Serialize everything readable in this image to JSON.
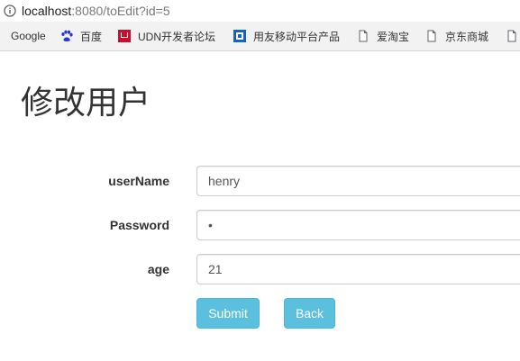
{
  "browser": {
    "url_host": "localhost",
    "url_rest": ":8080/toEdit?id=5",
    "bookmarks": [
      {
        "label": "Google",
        "icon": "none"
      },
      {
        "label": "百度",
        "icon": "baidu-paw-icon"
      },
      {
        "label": "UDN开发者论坛",
        "icon": "udn-icon"
      },
      {
        "label": "用友移动平台产品",
        "icon": "yonyou-icon"
      },
      {
        "label": "爱淘宝",
        "icon": "page-icon"
      },
      {
        "label": "京东商城",
        "icon": "page-icon"
      },
      {
        "label": "",
        "icon": "page-icon"
      }
    ]
  },
  "page": {
    "title": "修改用户",
    "fields": [
      {
        "label": "userName",
        "value": "henry",
        "type": "text"
      },
      {
        "label": "Password",
        "value": "•",
        "type": "password"
      },
      {
        "label": "age",
        "value": "21",
        "type": "text"
      }
    ],
    "submit_label": "Submit",
    "back_label": "Back"
  },
  "colors": {
    "button_bg": "#5bc0de",
    "button_border": "#46b8da",
    "title_text": "#333333"
  }
}
